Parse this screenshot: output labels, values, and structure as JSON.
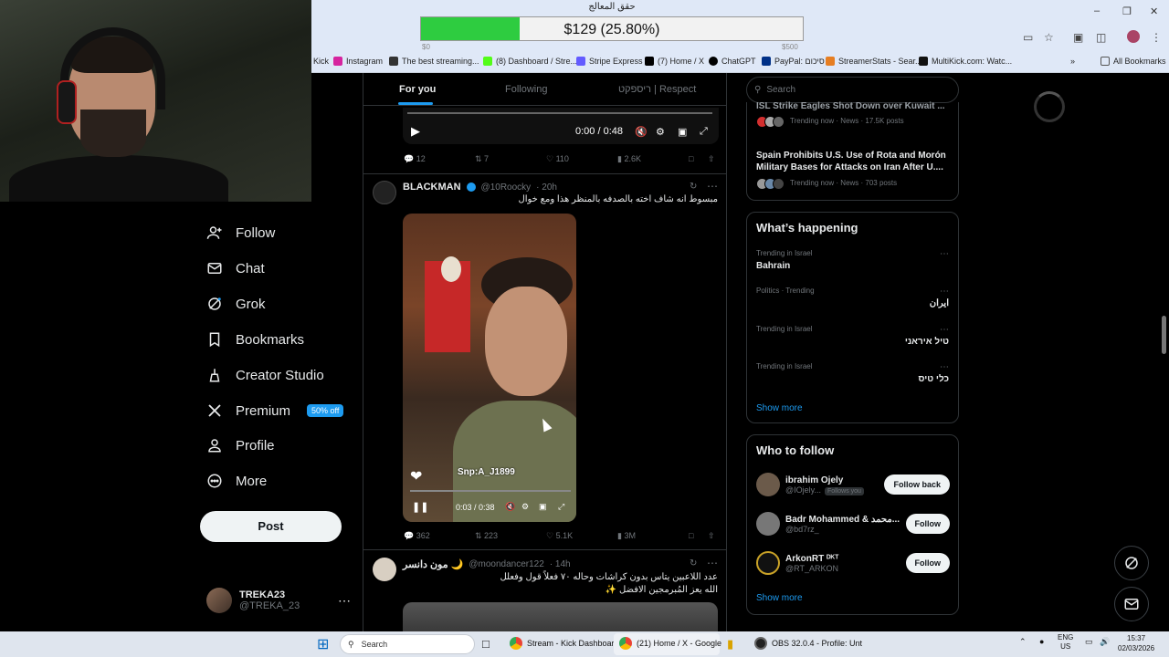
{
  "browser": {
    "bookmarks": [
      {
        "label": "Kick",
        "icon": "kick-icon",
        "color": "#53fc18"
      },
      {
        "label": "Instagram",
        "icon": "instagram-icon",
        "color": "#d6249f"
      },
      {
        "label": "The best streaming...",
        "icon": "page-icon",
        "color": "#333333"
      },
      {
        "label": "(8) Dashboard / Stre...",
        "icon": "kick-icon",
        "color": "#53fc18"
      },
      {
        "label": "Stripe Express",
        "icon": "stripe-icon",
        "color": "#635bff"
      },
      {
        "label": "(7) Home / X",
        "icon": "x-icon",
        "color": "#000000"
      },
      {
        "label": "ChatGPT",
        "icon": "chatgpt-icon",
        "color": "#000000"
      },
      {
        "label": "PayPal: סיכום",
        "icon": "paypal-icon",
        "color": "#003087"
      },
      {
        "label": "StreamerStats - Sear...",
        "icon": "page-icon",
        "color": "#e67e22"
      },
      {
        "label": "MultiKick.com: Watc...",
        "icon": "multikick-icon",
        "color": "#111111"
      }
    ],
    "all_bookmarks": "All Bookmarks"
  },
  "overlay": {
    "title": "حقق المعالج",
    "text": "$129 (25.80%)",
    "progress": 0.258,
    "min": "$0",
    "max": "$500"
  },
  "sidebar": {
    "items": [
      {
        "label": "Follow",
        "icon": "follow-icon"
      },
      {
        "label": "Chat",
        "icon": "chat-icon"
      },
      {
        "label": "Grok",
        "icon": "grok-icon"
      },
      {
        "label": "Bookmarks",
        "icon": "bookmark-icon"
      },
      {
        "label": "Creator Studio",
        "icon": "creator-studio-icon"
      },
      {
        "label": "Premium",
        "icon": "x-logo-icon",
        "badge": "50% off"
      },
      {
        "label": "Profile",
        "icon": "profile-icon"
      },
      {
        "label": "More",
        "icon": "more-icon"
      }
    ],
    "post_label": "Post",
    "account": {
      "name": "TREKA23",
      "handle": "@TREKA_23"
    }
  },
  "feed": {
    "tabs": [
      "For you",
      "Following",
      "ריספקט | Respect"
    ],
    "tweet1": {
      "time": "0:00 / 0:48",
      "replies": "12",
      "reposts": "7",
      "likes": "110",
      "views": "2.6K"
    },
    "tweet2": {
      "name": "BLACKMAN",
      "handle": "@10Roocky",
      "age": "· 20h",
      "text": "مبسوط انه شاف اخته بالصدفه بالمنظر هذا ومع خوال",
      "snap": "Snp:A_J1899",
      "time": "0:03 / 0:38",
      "replies": "362",
      "reposts": "223",
      "likes": "5.1K",
      "views": "3M"
    },
    "tweet3": {
      "name": "مون دانسر 🌙",
      "handle": "@moondancer122",
      "age": "· 14h",
      "text1": "عدد اللاعبين يتاس بدون كراشات وحاله ٧٠ فعلاً قول وفعلل",
      "text2": "الله يعز المُبرمجين الافضل ✨"
    }
  },
  "right": {
    "search_placeholder": "Search",
    "news": [
      {
        "title": "ISL Strike Eagles Shot Down over Kuwait ...",
        "meta": "Trending now · News · 17.5K posts"
      },
      {
        "title": "Spain Prohibits U.S. Use of Rota and Morón Military Bases for Attacks on Iran After U....",
        "meta": "Trending now · News · 703 posts"
      }
    ],
    "happening": {
      "title": "What’s happening",
      "trends": [
        {
          "category": "Trending in Israel",
          "name": "Bahrain"
        },
        {
          "category": "Politics · Trending",
          "name": "ایران"
        },
        {
          "category": "Trending in Israel",
          "name": "טיל איראני"
        },
        {
          "category": "Trending in Israel",
          "name": "כלי טיס"
        }
      ],
      "show_more": "Show more"
    },
    "who_to_follow": {
      "title": "Who to follow",
      "users": [
        {
          "name": "ibrahim Ojely",
          "handle": "@IOjely...",
          "follows_you": "Follows you",
          "button": "Follow back",
          "color": "#6b5a4a"
        },
        {
          "name": "Badr Mohammed & محمد...",
          "handle": "@bd7rz_",
          "follows_you": "",
          "button": "Follow",
          "color": "#777777"
        },
        {
          "name": "ArkonRT ᴰᴷᵀ",
          "handle": "@RT_ARKON",
          "follows_you": "",
          "button": "Follow",
          "color": "#c9a227"
        }
      ],
      "show_more": "Show more"
    }
  },
  "taskbar": {
    "search": "Search",
    "apps": [
      {
        "label": "Stream - Kick Dashboar",
        "icon": "chrome-icon"
      },
      {
        "label": "(21) Home / X - Google",
        "icon": "chrome-icon"
      },
      {
        "label": "OBS 32.0.4 - Profile: Unt",
        "icon": "obs-icon"
      }
    ],
    "lang": "ENG",
    "region": "US",
    "time": "15:37",
    "date": "02/03/2026"
  }
}
